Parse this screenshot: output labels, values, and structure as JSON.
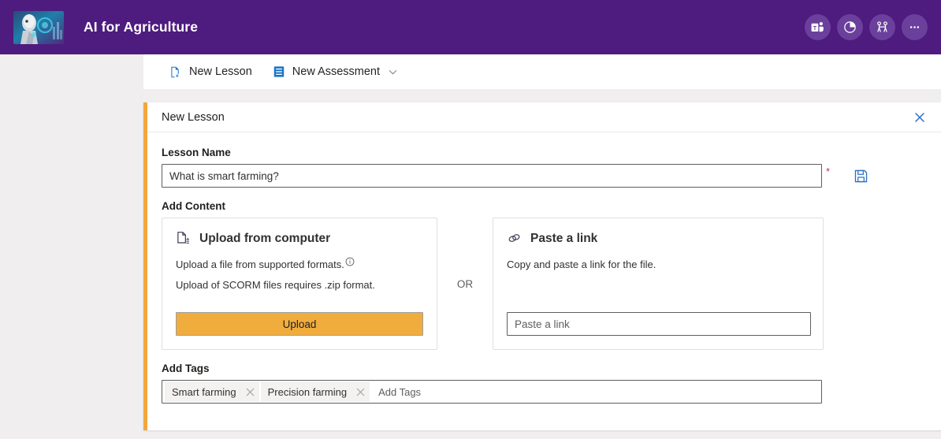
{
  "header": {
    "title": "AI for Agriculture",
    "thumbnail_name": "course-thumbnail",
    "bg_color": "#4e1b7f",
    "actions": [
      {
        "name": "teams-icon",
        "label": "Teams"
      },
      {
        "name": "insights-pie-chart-icon",
        "label": "Insights"
      },
      {
        "name": "people-collaborate-icon",
        "label": "Collaborate"
      },
      {
        "name": "more-options-icon",
        "label": "More options"
      }
    ]
  },
  "toolbar": {
    "new_lesson_label": "New Lesson",
    "new_assessment_label": "New Assessment",
    "chevron": "chevron-down-icon"
  },
  "panel": {
    "title": "New Lesson",
    "accent_color": "#f2a73b",
    "close_label": "Close",
    "lesson_name": {
      "label": "Lesson Name",
      "value": "What is smart farming?",
      "placeholder": "",
      "required_marker": "*",
      "required_color": "#c4314b",
      "save_label": "Save"
    },
    "add_content": {
      "label": "Add Content",
      "or_label": "OR",
      "upload_card": {
        "title": "Upload from computer",
        "desc1": "Upload a file from supported formats.",
        "desc2": "Upload of SCORM files requires .zip format.",
        "button_label": "Upload",
        "button_color": "#f0ad3e"
      },
      "link_card": {
        "title": "Paste a link",
        "desc": "Copy and paste a link for the file.",
        "input_value": "",
        "input_placeholder": "Paste a link"
      }
    },
    "add_tags": {
      "label": "Add Tags",
      "placeholder": "Add Tags",
      "value": "",
      "tags": [
        {
          "label": "Smart farming"
        },
        {
          "label": "Precision farming"
        }
      ]
    }
  }
}
